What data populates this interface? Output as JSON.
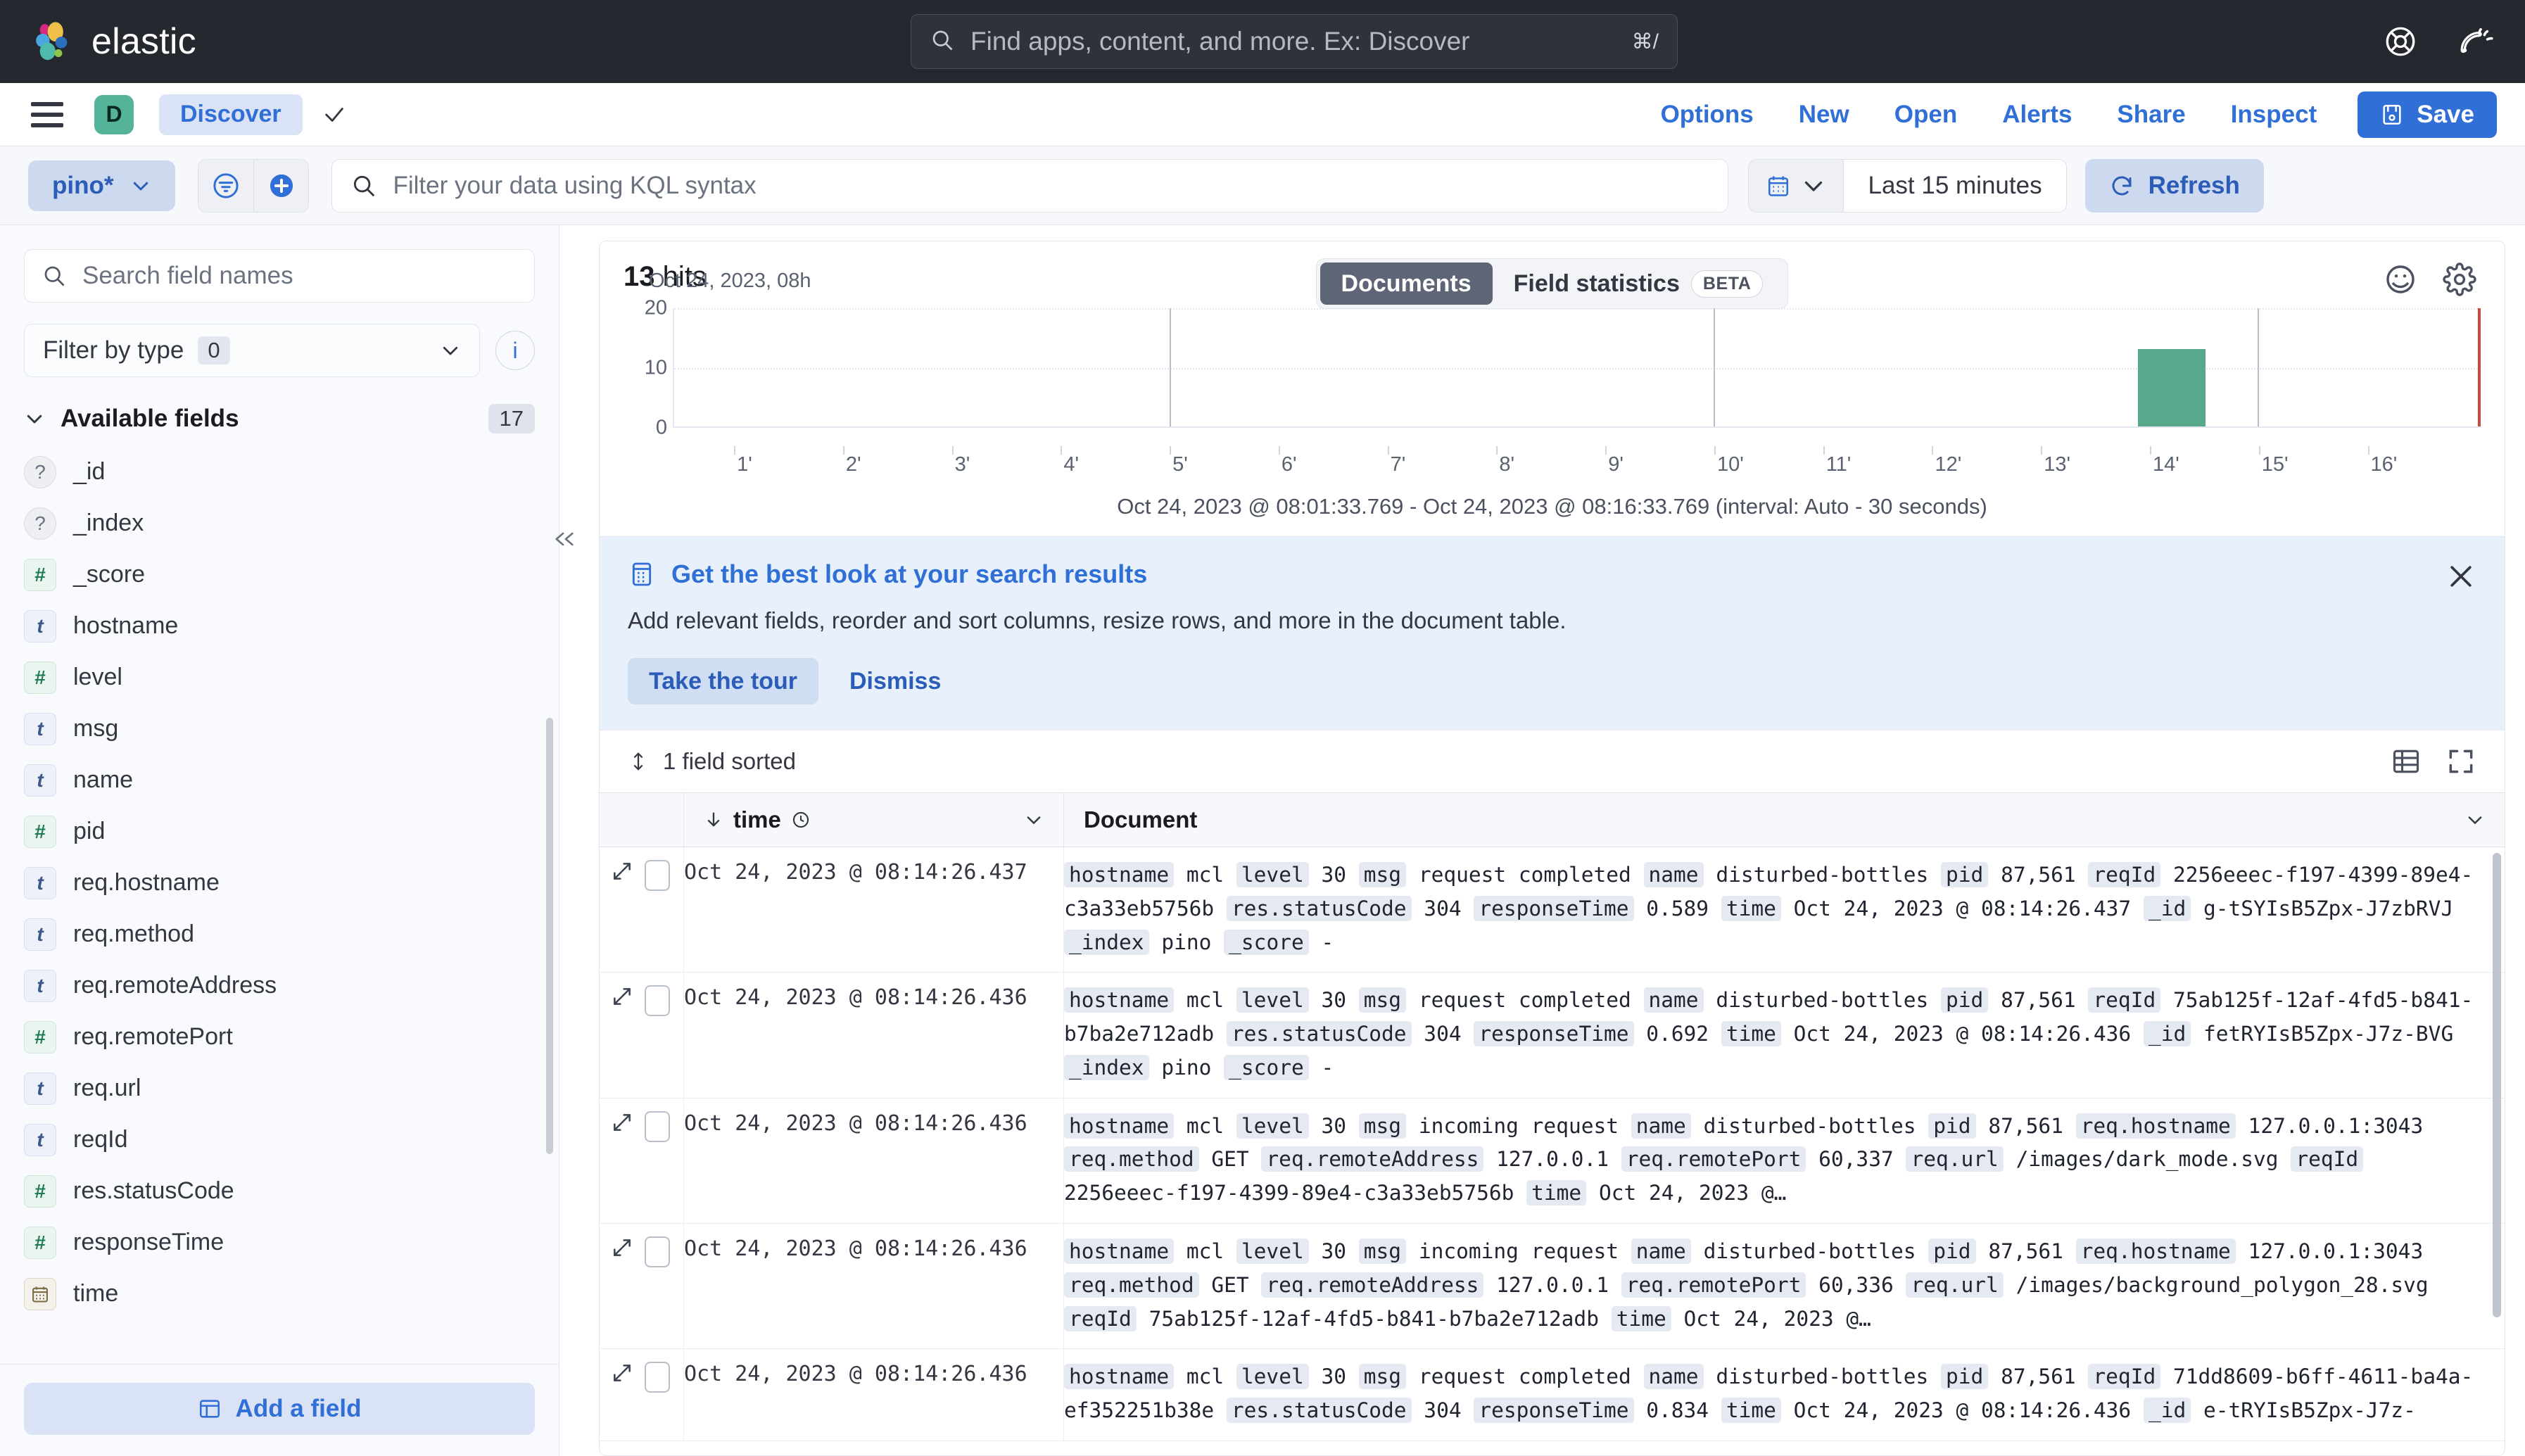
{
  "topnav": {
    "brand": "elastic",
    "search_placeholder": "Find apps, content, and more. Ex: Discover",
    "search_kbd": "⌘/",
    "icons": [
      "help-icon",
      "news-icon"
    ]
  },
  "appbar": {
    "space_initial": "D",
    "breadcrumb": "Discover",
    "links": [
      "Options",
      "New",
      "Open",
      "Alerts",
      "Share",
      "Inspect"
    ],
    "save_label": "Save"
  },
  "querybar": {
    "data_view": "pino*",
    "kql_placeholder": "Filter your data using KQL syntax",
    "time_value": "Last 15 minutes",
    "refresh_label": "Refresh"
  },
  "sidebar": {
    "search_placeholder": "Search field names",
    "filter_label": "Filter by type",
    "filter_count": "0",
    "group_label": "Available fields",
    "group_count": "17",
    "fields": [
      {
        "name": "_id",
        "type": "u"
      },
      {
        "name": "_index",
        "type": "u"
      },
      {
        "name": "_score",
        "type": "n"
      },
      {
        "name": "hostname",
        "type": "t"
      },
      {
        "name": "level",
        "type": "n"
      },
      {
        "name": "msg",
        "type": "t"
      },
      {
        "name": "name",
        "type": "t"
      },
      {
        "name": "pid",
        "type": "n"
      },
      {
        "name": "req.hostname",
        "type": "t"
      },
      {
        "name": "req.method",
        "type": "t"
      },
      {
        "name": "req.remoteAddress",
        "type": "t"
      },
      {
        "name": "req.remotePort",
        "type": "n"
      },
      {
        "name": "req.url",
        "type": "t"
      },
      {
        "name": "reqId",
        "type": "t"
      },
      {
        "name": "res.statusCode",
        "type": "n"
      },
      {
        "name": "responseTime",
        "type": "n"
      },
      {
        "name": "time",
        "type": "d"
      }
    ],
    "add_field_label": "Add a field"
  },
  "main": {
    "hits_count": "13",
    "hits_label": "hits",
    "tab_documents": "Documents",
    "tab_field_statistics": "Field statistics",
    "beta_badge": "BETA",
    "chart_range": "Oct 24, 2023 @ 08:01:33.769 - Oct 24, 2023 @ 08:16:33.769 (interval: Auto - 30 seconds)"
  },
  "chart_data": {
    "type": "bar",
    "title": "",
    "xlabel": "",
    "ylabel": "",
    "ylim": [
      0,
      20
    ],
    "yticks": [
      "0",
      "10",
      "20"
    ],
    "categories": [
      "1'",
      "2'",
      "3'",
      "4'",
      "5'",
      "6'",
      "7'",
      "8'",
      "9'",
      "10'",
      "11'",
      "12'",
      "13'",
      "14'",
      "15'",
      "16'"
    ],
    "values": [
      0,
      0,
      0,
      0,
      0,
      0,
      0,
      0,
      0,
      0,
      0,
      0,
      0,
      13,
      0,
      0
    ],
    "axis_date_label": "Oct 24, 2023, 08h",
    "grid": true,
    "legend": "none",
    "bar_color": "#58a88c",
    "end_marker_color": "#c9493b"
  },
  "callout": {
    "title": "Get the best look at your search results",
    "body": "Add relevant fields, reorder and sort columns, resize rows, and more in the document table.",
    "primary_action": "Take the tour",
    "secondary_action": "Dismiss"
  },
  "table": {
    "sort_label": "1 field sorted",
    "col_time": "time",
    "col_document": "Document",
    "rows": [
      {
        "time": "Oct 24, 2023 @ 08:14:26.437",
        "doc": "hostname mcl level 30 msg request completed name disturbed-bottles pid 87,561 reqId 2256eeec-f197-4399-89e4-c3a33eb5756b res.statusCode 304 responseTime 0.589 time Oct 24, 2023 @ 08:14:26.437 _id g-tSYIsB5Zpx-J7zbRVJ _index pino _score  -",
        "keys": [
          "hostname",
          "level",
          "msg",
          "name",
          "pid",
          "reqId",
          "res.statusCode",
          "responseTime",
          "time",
          "_id",
          "_index",
          "_score"
        ]
      },
      {
        "time": "Oct 24, 2023 @ 08:14:26.436",
        "doc": "hostname mcl level 30 msg request completed name disturbed-bottles pid 87,561 reqId 75ab125f-12af-4fd5-b841-b7ba2e712adb res.statusCode 304 responseTime 0.692 time Oct 24, 2023 @ 08:14:26.436 _id fetRYIsB5Zpx-J7z-BVG _index pino _score  -",
        "keys": [
          "hostname",
          "level",
          "msg",
          "name",
          "pid",
          "reqId",
          "res.statusCode",
          "responseTime",
          "time",
          "_id",
          "_index",
          "_score"
        ]
      },
      {
        "time": "Oct 24, 2023 @ 08:14:26.436",
        "doc": "hostname mcl level 30 msg incoming request name disturbed-bottles pid 87,561 req.hostname 127.0.0.1:3043 req.method GET req.remoteAddress 127.0.0.1 req.remotePort 60,337 req.url /images/dark_mode.svg reqId 2256eeec-f197-4399-89e4-c3a33eb5756b time Oct 24, 2023 @…",
        "keys": [
          "hostname",
          "level",
          "msg",
          "name",
          "pid",
          "req.hostname",
          "req.method",
          "req.remoteAddress",
          "req.remotePort",
          "req.url",
          "reqId",
          "time"
        ]
      },
      {
        "time": "Oct 24, 2023 @ 08:14:26.436",
        "doc": "hostname mcl level 30 msg incoming request name disturbed-bottles pid 87,561 req.hostname 127.0.0.1:3043 req.method GET req.remoteAddress 127.0.0.1 req.remotePort 60,336 req.url /images/background_polygon_28.svg reqId 75ab125f-12af-4fd5-b841-b7ba2e712adb time Oct 24, 2023 @…",
        "keys": [
          "hostname",
          "level",
          "msg",
          "name",
          "pid",
          "req.hostname",
          "req.method",
          "req.remoteAddress",
          "req.remotePort",
          "req.url",
          "reqId",
          "time"
        ]
      },
      {
        "time": "Oct 24, 2023 @ 08:14:26.436",
        "doc": "hostname mcl level 30 msg request completed name disturbed-bottles pid 87,561 reqId 71dd8609-b6ff-4611-ba4a-ef352251b38e res.statusCode 304 responseTime 0.834 time Oct 24, 2023 @ 08:14:26.436 _id e-tRYIsB5Zpx-J7z-",
        "keys": [
          "hostname",
          "level",
          "msg",
          "name",
          "pid",
          "reqId",
          "res.statusCode",
          "responseTime",
          "time",
          "_id"
        ]
      }
    ]
  },
  "colors": {
    "brand_dark": "#25282f",
    "accent_blue": "#2f6fd6",
    "space_green": "#54b399",
    "bar_green": "#58a88c",
    "end_red": "#c9493b"
  }
}
